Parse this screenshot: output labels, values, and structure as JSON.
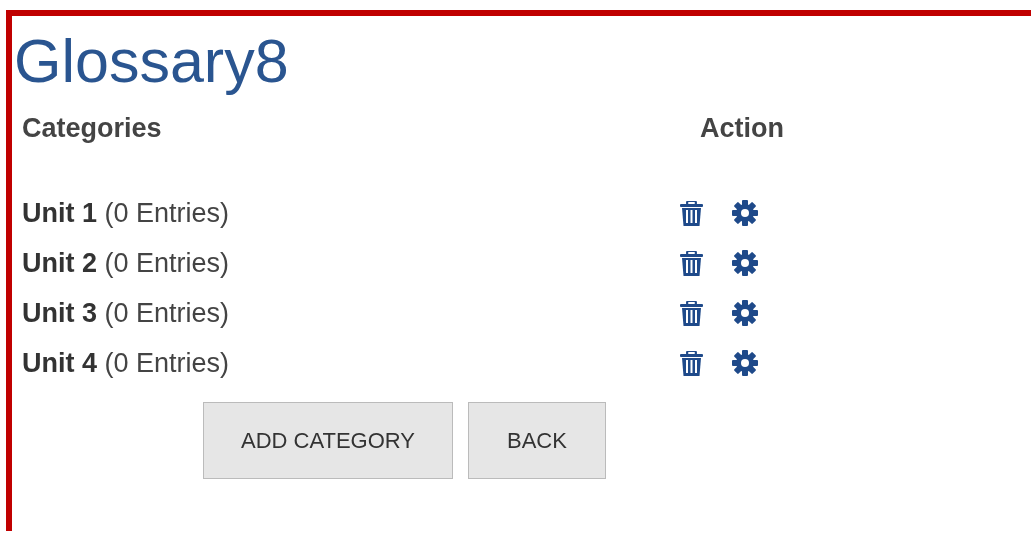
{
  "title": "Glossary8",
  "columns": [
    "Categories",
    "Action"
  ],
  "categories": [
    {
      "label": "**Unit 1** (0 Entries)"
    },
    {
      "label": "**Unit 2** (0 Entries)"
    },
    {
      "label": "**Unit 3** (0 Entries)"
    },
    {
      "label": "**Unit 4** (0 Entries)"
    }
  ],
  "buttons": [
    "ADD CATEGORY",
    "BACK"
  ]
}
